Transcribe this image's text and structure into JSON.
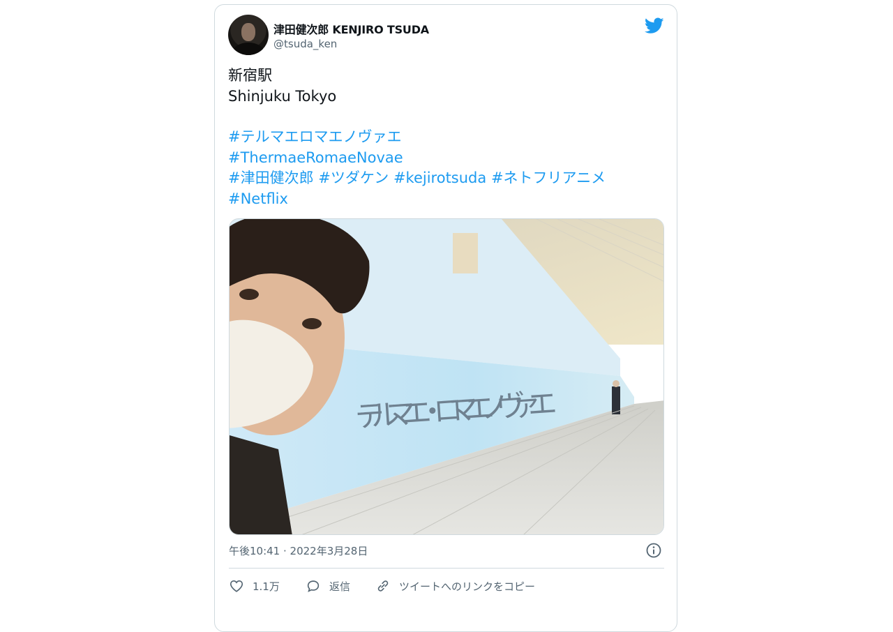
{
  "author": {
    "display_name": "津田健次郎 KENJIRO TSUDA",
    "handle": "@tsuda_ken",
    "avatar_icon": "user-avatar"
  },
  "brand": {
    "icon": "twitter-bird-icon",
    "color": "#1d9bf0"
  },
  "tweet": {
    "line1": "新宿駅",
    "line2": "Shinjuku Tokyo",
    "hashtags": {
      "t1": "#テルマエロマエノヴァエ",
      "t2": "#ThermaeRomaeNovae",
      "t3": "#津田健次郎",
      "t4": "#ツダケン",
      "t5": "#kejirotsuda",
      "t6": "#ネトフリアニメ",
      "t7": "#Netflix"
    },
    "photo_sign_text": "テルマエ・ロマエノヴァエ"
  },
  "timestamp": "午後10:41 · 2022年3月28日",
  "actions": {
    "like_count": "1.1万",
    "reply_label": "返信",
    "copy_link_label": "ツイートへのリンクをコピー"
  }
}
